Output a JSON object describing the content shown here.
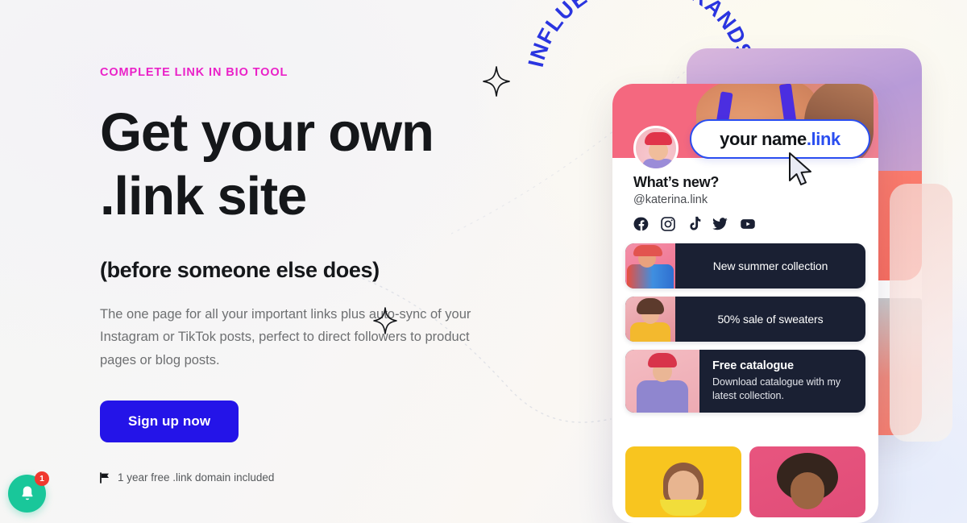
{
  "hero": {
    "eyebrow": "COMPLETE LINK IN BIO TOOL",
    "headline_line1": "Get your own",
    "headline_line2": ".link site",
    "subhead": "(before someone else does)",
    "body": "The one page for all your important links plus auto-sync of your Instagram or TikTok posts, perfect to direct followers to product pages or blog posts.",
    "cta_label": "Sign up now",
    "footnote": "1 year free .link domain included",
    "flag_icon": "flag-icon"
  },
  "arc": {
    "text": "INFLUENCERS BRANDS CREATORS"
  },
  "profile": {
    "name_dark": "your name",
    "name_blue": ".link",
    "whats_new": "What’s new?",
    "handle": "@katerina.link",
    "socials": [
      {
        "name": "facebook-icon",
        "label": "Facebook"
      },
      {
        "name": "instagram-icon",
        "label": "Instagram"
      },
      {
        "name": "tiktok-icon",
        "label": "TikTok"
      },
      {
        "name": "twitter-icon",
        "label": "Twitter"
      },
      {
        "name": "youtube-icon",
        "label": "YouTube"
      }
    ],
    "links": [
      {
        "title": "New summer collection",
        "subtitle": ""
      },
      {
        "title": "50% sale of sweaters",
        "subtitle": ""
      },
      {
        "title": "Free catalogue",
        "subtitle": "Download catalogue with my latest collection."
      }
    ]
  },
  "notification": {
    "icon": "bell-icon",
    "count": "1"
  },
  "colors": {
    "accent_pink": "#ea21c8",
    "cta_blue": "#2414e8",
    "link_blue": "#2a4ef0",
    "card_dark": "#1a2033",
    "notif_green": "#19c79a",
    "badge_red": "#f0392f"
  }
}
